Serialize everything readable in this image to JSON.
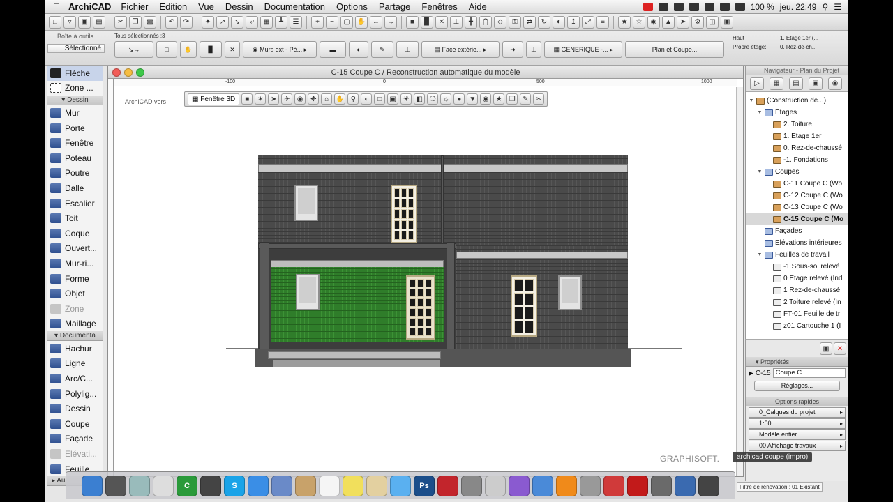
{
  "menubar": {
    "app_name": "ArchiCAD",
    "menus": [
      "Fichier",
      "Edition",
      "Vue",
      "Dessin",
      "Documentation",
      "Options",
      "Partage",
      "Fenêtres",
      "Aide"
    ],
    "battery": "100 %",
    "clock": "jeu. 22:49"
  },
  "infobox": {
    "toolbox_label": "Boîte à outils",
    "selection_label": "Sélectionné",
    "selected_count": "Tous sélectionnés :3",
    "wall_type": "Murs ext - Pé...",
    "face_label": "Face extérie...",
    "material": "GENERIQUE -...",
    "plan_label": "Plan et Coupe...",
    "top_label": "Haut",
    "own_floor_label": "Propre étage:",
    "top_value": "1. Etage 1er (...",
    "floor_value": "0. Rez-de-ch..."
  },
  "toolbox": {
    "arrow_label": "Flèche",
    "marquee_label": "Zone ...",
    "sections": {
      "design": "Dessin",
      "document": "Documenta"
    },
    "design_tools": [
      {
        "label": "Mur",
        "dim": false
      },
      {
        "label": "Porte",
        "dim": false
      },
      {
        "label": "Fenêtre",
        "dim": false
      },
      {
        "label": "Poteau",
        "dim": false
      },
      {
        "label": "Poutre",
        "dim": false
      },
      {
        "label": "Dalle",
        "dim": false
      },
      {
        "label": "Escalier",
        "dim": false
      },
      {
        "label": "Toit",
        "dim": false
      },
      {
        "label": "Coque",
        "dim": false
      },
      {
        "label": "Ouvert...",
        "dim": false
      },
      {
        "label": "Mur-ri...",
        "dim": false
      },
      {
        "label": "Forme",
        "dim": false
      },
      {
        "label": "Objet",
        "dim": false
      },
      {
        "label": "Zone",
        "dim": true
      },
      {
        "label": "Maillage",
        "dim": false
      }
    ],
    "document_tools": [
      {
        "label": "Hachur",
        "dim": false
      },
      {
        "label": "Ligne",
        "dim": false
      },
      {
        "label": "Arc/C...",
        "dim": false
      },
      {
        "label": "Polylig...",
        "dim": false
      },
      {
        "label": "Dessin",
        "dim": false
      },
      {
        "label": "Coupe",
        "dim": false
      },
      {
        "label": "Façade",
        "dim": false
      },
      {
        "label": "Elévati...",
        "dim": true
      },
      {
        "label": "Feuille...",
        "dim": false
      }
    ],
    "more_label": "Au"
  },
  "window": {
    "title": "C-15 Coupe C / Reconstruction automatique du modèle",
    "ruler_marks": [
      "-100",
      "0",
      "500",
      "1000"
    ],
    "archicad_version": "ArchiCAD vers",
    "view3d_label": "Fenêtre 3D",
    "brand": "GRAPHISOFT."
  },
  "navigator": {
    "title": "Navigateur - Plan du Projet",
    "tree": [
      {
        "label": "(Construction de...)",
        "level": 0,
        "icon": "folder",
        "toggle": "▼",
        "selected": false
      },
      {
        "label": "Etages",
        "level": 1,
        "icon": "blue",
        "toggle": "▼",
        "selected": false
      },
      {
        "label": "2. Toiture",
        "level": 2,
        "icon": "folder",
        "toggle": "",
        "selected": false
      },
      {
        "label": "1. Etage 1er",
        "level": 2,
        "icon": "folder",
        "toggle": "",
        "selected": false
      },
      {
        "label": "0. Rez-de-chaussé",
        "level": 2,
        "icon": "folder",
        "toggle": "",
        "selected": false
      },
      {
        "label": "-1. Fondations",
        "level": 2,
        "icon": "folder",
        "toggle": "",
        "selected": false
      },
      {
        "label": "Coupes",
        "level": 1,
        "icon": "blue",
        "toggle": "▼",
        "selected": false
      },
      {
        "label": "C-11 Coupe C (Wo",
        "level": 2,
        "icon": "folder",
        "toggle": "",
        "selected": false
      },
      {
        "label": "C-12 Coupe C (Wo",
        "level": 2,
        "icon": "folder",
        "toggle": "",
        "selected": false
      },
      {
        "label": "C-13 Coupe C (Wo",
        "level": 2,
        "icon": "folder",
        "toggle": "",
        "selected": false
      },
      {
        "label": "C-15 Coupe C (Mo",
        "level": 2,
        "icon": "folder",
        "toggle": "",
        "selected": true
      },
      {
        "label": "Façades",
        "level": 1,
        "icon": "blue",
        "toggle": "",
        "selected": false
      },
      {
        "label": "Elévations intérieures",
        "level": 1,
        "icon": "blue",
        "toggle": "",
        "selected": false
      },
      {
        "label": "Feuilles de travail",
        "level": 1,
        "icon": "blue",
        "toggle": "▼",
        "selected": false
      },
      {
        "label": "-1 Sous-sol relevé",
        "level": 2,
        "icon": "doc",
        "toggle": "",
        "selected": false
      },
      {
        "label": "0 Etage relevé (Ind",
        "level": 2,
        "icon": "doc",
        "toggle": "",
        "selected": false
      },
      {
        "label": "1 Rez-de-chaussé",
        "level": 2,
        "icon": "doc",
        "toggle": "",
        "selected": false
      },
      {
        "label": "2 Toiture relevé (In",
        "level": 2,
        "icon": "doc",
        "toggle": "",
        "selected": false
      },
      {
        "label": "FT-01 Feuille de tr",
        "level": 2,
        "icon": "doc",
        "toggle": "",
        "selected": false
      },
      {
        "label": "z01 Cartouche 1 (I",
        "level": 2,
        "icon": "doc",
        "toggle": "",
        "selected": false
      }
    ]
  },
  "properties": {
    "header": "Propriétés",
    "id": "C-15",
    "name": "Coupe C",
    "settings_button": "Réglages...",
    "quick_options": "Options rapides",
    "layers": "0_Calques du projet",
    "scale": "1:50",
    "model": "Modèle entier",
    "renovation": "00 Affichage travaux"
  },
  "tooltip": "archicad coupe (impro)",
  "status": "Filtre de rénovation : 01 Existant",
  "dock": [
    {
      "name": "finder-icon",
      "color": "#3b7fd1",
      "text": ""
    },
    {
      "name": "launchpad-icon",
      "color": "#555",
      "text": ""
    },
    {
      "name": "preview-icon",
      "color": "#9bb",
      "text": ""
    },
    {
      "name": "textedit-icon",
      "color": "#ddd",
      "text": ""
    },
    {
      "name": "camtasia-icon",
      "color": "#2a9a3a",
      "text": "C"
    },
    {
      "name": "archicad-dock-icon",
      "color": "#444",
      "text": ""
    },
    {
      "name": "skype-icon",
      "color": "#1aa3e8",
      "text": "S"
    },
    {
      "name": "safari-icon",
      "color": "#3a8ee6",
      "text": ""
    },
    {
      "name": "mail-icon",
      "color": "#6a8ac8",
      "text": ""
    },
    {
      "name": "contacts-icon",
      "color": "#c8a26a",
      "text": ""
    },
    {
      "name": "calendar-icon",
      "color": "#f5f5f5",
      "text": ""
    },
    {
      "name": "notes-icon",
      "color": "#f1df5c",
      "text": ""
    },
    {
      "name": "photos-icon",
      "color": "#e3d0a0",
      "text": ""
    },
    {
      "name": "messages-icon",
      "color": "#5ab0f0",
      "text": ""
    },
    {
      "name": "photoshop-icon",
      "color": "#1b4e8a",
      "text": "Ps"
    },
    {
      "name": "flashcard-icon",
      "color": "#c2252c",
      "text": ""
    },
    {
      "name": "vlc-icon",
      "color": "#888",
      "text": ""
    },
    {
      "name": "editor-icon",
      "color": "#ccc",
      "text": ""
    },
    {
      "name": "stats-icon",
      "color": "#8a5ad0",
      "text": ""
    },
    {
      "name": "network-icon",
      "color": "#4a8ad8",
      "text": ""
    },
    {
      "name": "books-icon",
      "color": "#f08a1a",
      "text": ""
    },
    {
      "name": "system-prefs-icon",
      "color": "#999",
      "text": ""
    },
    {
      "name": "sketch-icon",
      "color": "#d03a3a",
      "text": ""
    },
    {
      "name": "acrobat-icon",
      "color": "#c21a1a",
      "text": ""
    },
    {
      "name": "road-icon",
      "color": "#6a6a6a",
      "text": ""
    },
    {
      "name": "globe-icon",
      "color": "#3a6ab0",
      "text": ""
    },
    {
      "name": "bar-icon",
      "color": "#444",
      "text": ""
    }
  ]
}
